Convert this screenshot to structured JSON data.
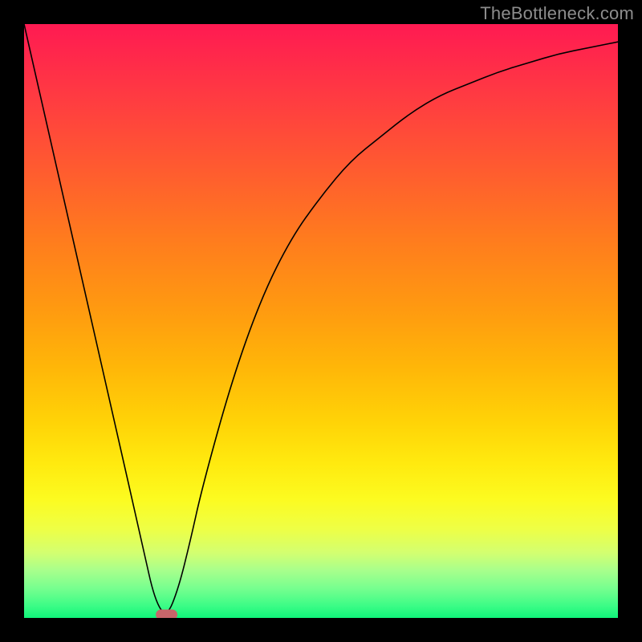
{
  "watermark": "TheBottleneck.com",
  "chart_data": {
    "type": "line",
    "title": "",
    "xlabel": "",
    "ylabel": "",
    "xlim": [
      0,
      100
    ],
    "ylim": [
      0,
      100
    ],
    "grid": false,
    "legend": false,
    "series": [
      {
        "name": "bottleneck-curve",
        "x": [
          0,
          5,
          10,
          15,
          20,
          22,
          24,
          26,
          28,
          30,
          35,
          40,
          45,
          50,
          55,
          60,
          65,
          70,
          75,
          80,
          85,
          90,
          95,
          100
        ],
        "y": [
          100,
          78,
          56,
          34,
          12,
          3,
          0,
          5,
          13,
          22,
          40,
          54,
          64,
          71,
          77,
          81,
          85,
          88,
          90,
          92,
          93.5,
          95,
          96,
          97
        ]
      }
    ],
    "marker": {
      "x": 24,
      "y": 0,
      "shape": "rounded-rect",
      "color": "#c8656a"
    },
    "frame_background": "#000000",
    "gradient_stops": [
      {
        "pos": 0.0,
        "color": "#ff1a52"
      },
      {
        "pos": 0.48,
        "color": "#ff9a10"
      },
      {
        "pos": 0.8,
        "color": "#fcfb20"
      },
      {
        "pos": 1.0,
        "color": "#10f47a"
      }
    ]
  }
}
